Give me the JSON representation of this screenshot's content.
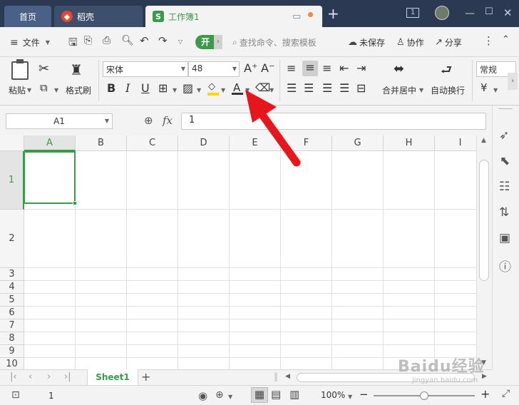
{
  "titlebar": {
    "tabs": [
      {
        "label": "首页"
      },
      {
        "label": "稻壳"
      },
      {
        "label": "工作簿1"
      }
    ],
    "page_counter": "1",
    "new_tab": "+"
  },
  "menubar": {
    "file_label": "文件",
    "start_tab": "开",
    "search_placeholder": "查找命令、搜索模板",
    "unsaved_label": "未保存",
    "collab_label": "协作",
    "share_label": "分享"
  },
  "ribbon": {
    "paste_label": "粘贴",
    "format_painter_label": "格式刷",
    "font_name": "宋体",
    "font_size": "48",
    "merge_center_label": "合并居中",
    "wrap_text_label": "自动换行",
    "number_format": "常规",
    "currency_symbol": "¥"
  },
  "formula_bar": {
    "name_box": "A1",
    "fx_label": "fx",
    "formula_value": "1"
  },
  "grid": {
    "columns": [
      "A",
      "B",
      "C",
      "D",
      "E",
      "F",
      "G",
      "H",
      "I"
    ],
    "rows": [
      "1",
      "2",
      "3",
      "4",
      "5",
      "6",
      "7",
      "8",
      "9",
      "10"
    ],
    "selected_cell": "A1"
  },
  "sheetbar": {
    "sheets": [
      "Sheet1"
    ],
    "add_sheet": "+"
  },
  "statusbar": {
    "page_number": "1",
    "zoom_level": "100%",
    "zoom_fraction": 0.5,
    "zoom_minus": "−",
    "zoom_plus": "+"
  },
  "watermark": {
    "brand": "Baidu经验",
    "url": "jingyan.baidu.com"
  },
  "colors": {
    "accent_green": "#3a9a4a",
    "annotation_red": "#e8161c",
    "titlebar_bg": "#2b3a52"
  }
}
